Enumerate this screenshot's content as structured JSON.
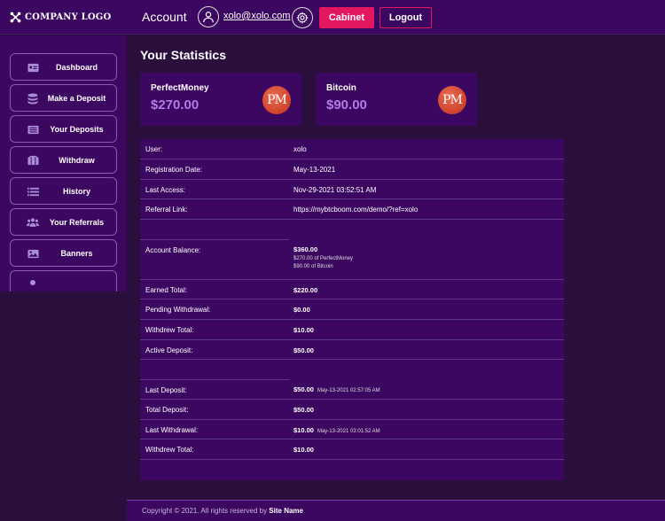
{
  "header": {
    "logo_text": "COMPANY LOGO",
    "title": "Account",
    "email": "xolo@xolo.com",
    "cabinet_label": "Cabinet",
    "logout_label": "Logout",
    "accent_color": "#e3175f"
  },
  "sidebar": {
    "items": [
      {
        "label": "Dashboard",
        "icon": "id-card-icon"
      },
      {
        "label": "Make a Deposit",
        "icon": "coins-icon"
      },
      {
        "label": "Your Deposits",
        "icon": "list-alt-icon"
      },
      {
        "label": "Withdraw",
        "icon": "wallet-icon"
      },
      {
        "label": "History",
        "icon": "list-icon"
      },
      {
        "label": "Your Referrals",
        "icon": "users-icon"
      },
      {
        "label": "Banners",
        "icon": "image-icon"
      }
    ]
  },
  "main": {
    "title": "Your Statistics",
    "cards": [
      {
        "name": "PerfectMoney",
        "amount": "$270.00",
        "badge": "PM"
      },
      {
        "name": "Bitcoin",
        "amount": "$90.00",
        "badge": "PM"
      }
    ],
    "stats": {
      "user_label": "User:",
      "user_value": "xolo",
      "reg_label": "Registration Date:",
      "reg_value": "May-13-2021",
      "last_access_label": "Last Access:",
      "last_access_value": "Nov-29-2021 03:52:51 AM",
      "referral_label": "Referral Link:",
      "referral_value": "https://mybtcboom.com/demo/?ref=xolo",
      "balance_label": "Account Balance:",
      "balance_value": "$360.00",
      "balance_pm": "$270.00 of PerfectMoney",
      "balance_btc": "$90.00 of Bitcoin",
      "earned_label": "Earned Total:",
      "earned_value": "$220.00",
      "pending_label": "Pending Withdrawal:",
      "pending_value": "$0.00",
      "withdrew_label": "Withdrew Total:",
      "withdrew_value": "$10.00",
      "active_label": "Active Deposit:",
      "active_value": "$50.00",
      "last_deposit_label": "Last Deposit:",
      "last_deposit_value": "$50.00",
      "last_deposit_date": "May-13-2021 02:57:05 AM",
      "total_deposit_label": "Total Deposit:",
      "total_deposit_value": "$50.00",
      "last_withdrawal_label": "Last Withdrawal:",
      "last_withdrawal_value": "$10.00",
      "last_withdrawal_date": "May-13-2021 03:01:52 AM",
      "withdrew_total2_label": "Withdrew Total:",
      "withdrew_total2_value": "$10.00"
    }
  },
  "footer": {
    "copyright": "Copyright © 2021. All rights reserved by ",
    "site_name": "Site Name"
  }
}
